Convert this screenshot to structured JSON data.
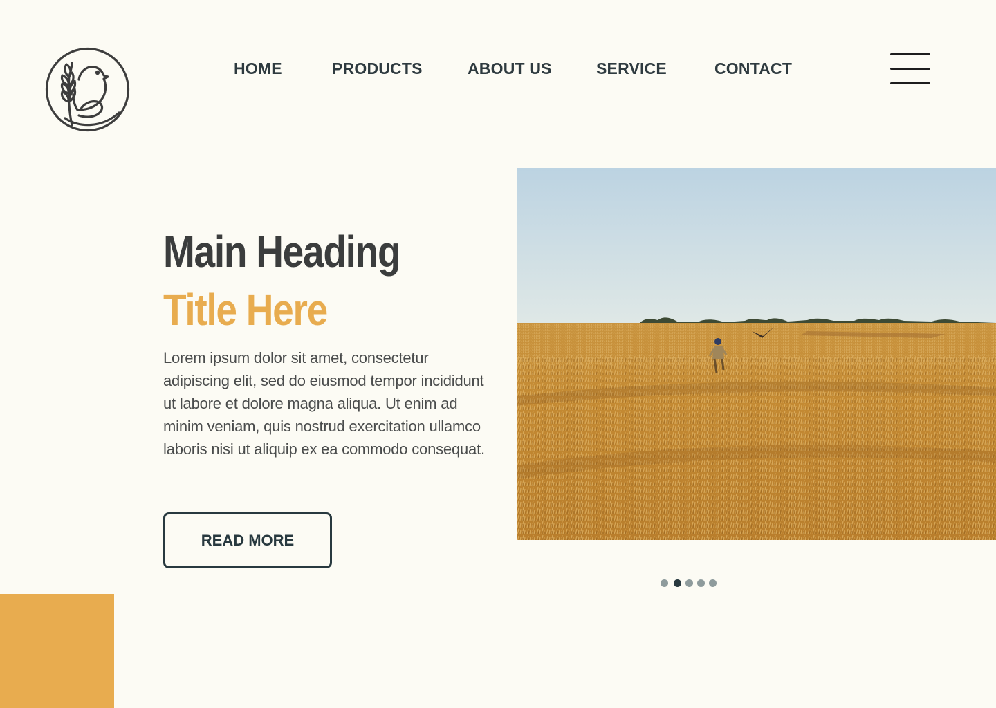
{
  "nav": {
    "items": [
      {
        "label": "HOME"
      },
      {
        "label": "PRODUCTS"
      },
      {
        "label": "ABOUT US"
      },
      {
        "label": "SERVICE"
      },
      {
        "label": "CONTACT"
      }
    ]
  },
  "hero": {
    "heading_line1": "Main Heading",
    "heading_line2": "Title Here",
    "body": "Lorem ipsum dolor sit amet, consectetur adipiscing elit, sed do eiusmod tempor incididunt ut labore et dolore magna aliqua. Ut enim ad minim veniam, quis nostrud exercitation ullamco laboris nisi ut aliquip ex ea commodo consequat.",
    "button_label": "READ MORE"
  },
  "slider": {
    "count": 5,
    "active_index": 1
  },
  "icons": {
    "logo": "bird-wheat-logo-icon",
    "menu": "hamburger-menu-icon"
  },
  "colors": {
    "background": "#fcfbf4",
    "accent": "#e8ac4f",
    "dark": "#28393f",
    "heading": "#3b3d3d"
  }
}
